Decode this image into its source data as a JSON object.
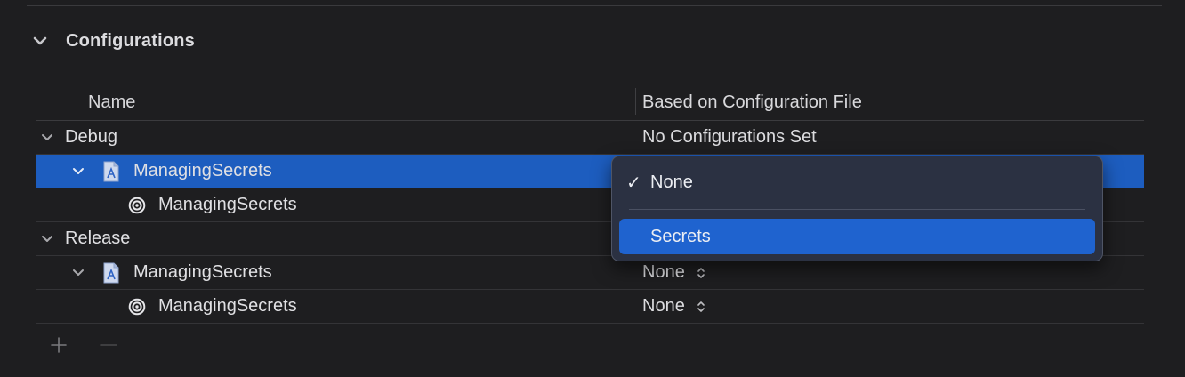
{
  "section": {
    "title": "Configurations",
    "expand_icon": "chevron-down-icon"
  },
  "table": {
    "columns": [
      "Name",
      "Based on Configuration File"
    ],
    "rows": [
      {
        "level": 0,
        "name": "Debug",
        "icon": "chevron-down-icon",
        "value": "No Configurations Set",
        "selected": false
      },
      {
        "level": 1,
        "name": "ManagingSecrets",
        "icon": "project-file-icon",
        "value": "",
        "selected": true
      },
      {
        "level": 2,
        "name": "ManagingSecrets",
        "icon": "target-icon",
        "value": "",
        "selected": false
      },
      {
        "level": 0,
        "name": "Release",
        "icon": "chevron-down-icon",
        "value": "",
        "selected": false
      },
      {
        "level": 1,
        "name": "ManagingSecrets",
        "icon": "project-file-icon",
        "value": "None",
        "selected": false
      },
      {
        "level": 2,
        "name": "ManagingSecrets",
        "icon": "target-icon",
        "value": "None",
        "selected": false
      }
    ]
  },
  "popup": {
    "items": [
      {
        "label": "None",
        "checked": true,
        "check_glyph": "✓"
      },
      {
        "label": "Secrets",
        "highlighted": true
      }
    ]
  },
  "bottom_bar": {
    "add_icon": "plus-icon",
    "remove_icon": "minus-icon"
  },
  "colors": {
    "background": "#1e1e20",
    "selection": "#1d5dbf",
    "popup_bg": "#2b3142",
    "popup_highlight": "#1f63cf"
  }
}
